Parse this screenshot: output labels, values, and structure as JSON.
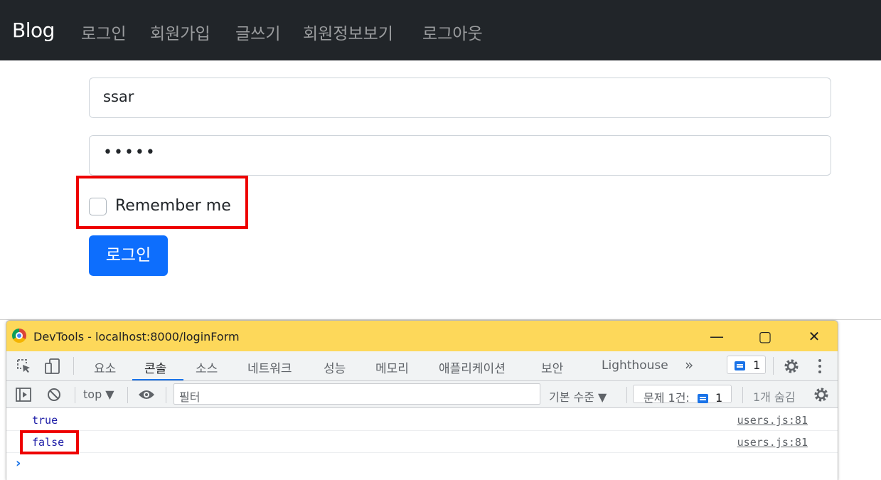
{
  "navbar": {
    "brand": "Blog",
    "links": [
      "로그인",
      "회원가입",
      "글쓰기",
      "회원정보보기",
      "로그아웃"
    ]
  },
  "form": {
    "username_value": "ssar",
    "password_value": "•••••",
    "remember_label": "Remember me",
    "remember_checked": false,
    "submit_label": "로그인"
  },
  "devtools": {
    "title": "DevTools - localhost:8000/loginForm",
    "window_buttons": {
      "minimize": "—",
      "maximize": "▢",
      "close": "✕"
    },
    "tabs": [
      "요소",
      "콘솔",
      "소스",
      "네트워크",
      "성능",
      "메모리",
      "애플리케이션",
      "보안",
      "Lighthouse"
    ],
    "active_tab": "콘솔",
    "more_tabs": "»",
    "issues_badge_count": "1",
    "filterbar": {
      "context": "top ▼",
      "filter_placeholder": "필터",
      "level": "기본 수준 ▼",
      "issues_prefix": "문제 1건:",
      "issues_count": "1",
      "hidden": "1개 숨김"
    },
    "console": [
      {
        "value": "true",
        "source": "users.js:81"
      },
      {
        "value": "false",
        "source": "users.js:81"
      }
    ],
    "prompt": "›"
  },
  "colors": {
    "navbar_bg": "#212529",
    "primary": "#0d6efd",
    "highlight": "#ee0000",
    "devtools_titlebar": "#fdd85a"
  }
}
